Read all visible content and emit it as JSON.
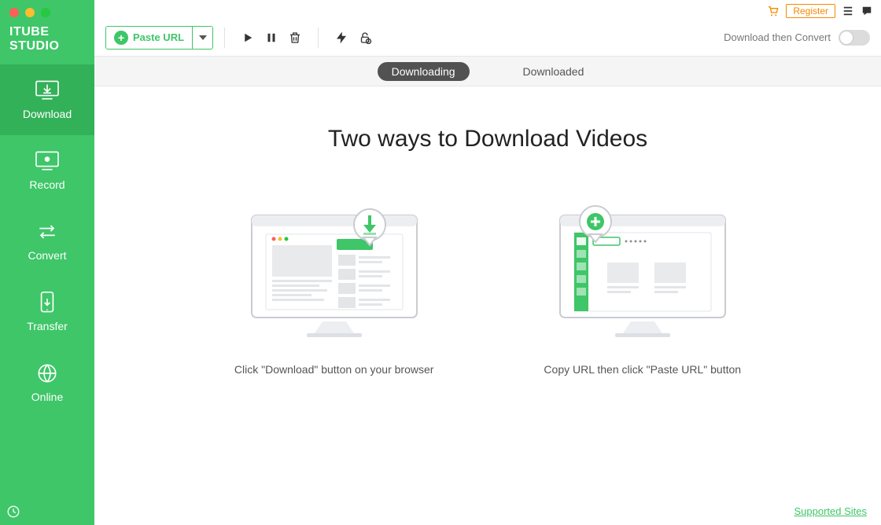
{
  "brand": "ITUBE STUDIO",
  "sidebar": {
    "items": [
      {
        "label": "Download"
      },
      {
        "label": "Record"
      },
      {
        "label": "Convert"
      },
      {
        "label": "Transfer"
      },
      {
        "label": "Online"
      }
    ]
  },
  "utility": {
    "register_label": "Register"
  },
  "toolbar": {
    "paste_label": "Paste URL",
    "dtc_label": "Download then Convert"
  },
  "tabs": {
    "downloading": "Downloading",
    "downloaded": "Downloaded"
  },
  "content": {
    "headline": "Two ways to Download Videos",
    "method1_caption": "Click \"Download\" button on your browser",
    "method2_caption": "Copy URL then click \"Paste URL\" button"
  },
  "footer": {
    "supported_sites": "Supported Sites"
  }
}
